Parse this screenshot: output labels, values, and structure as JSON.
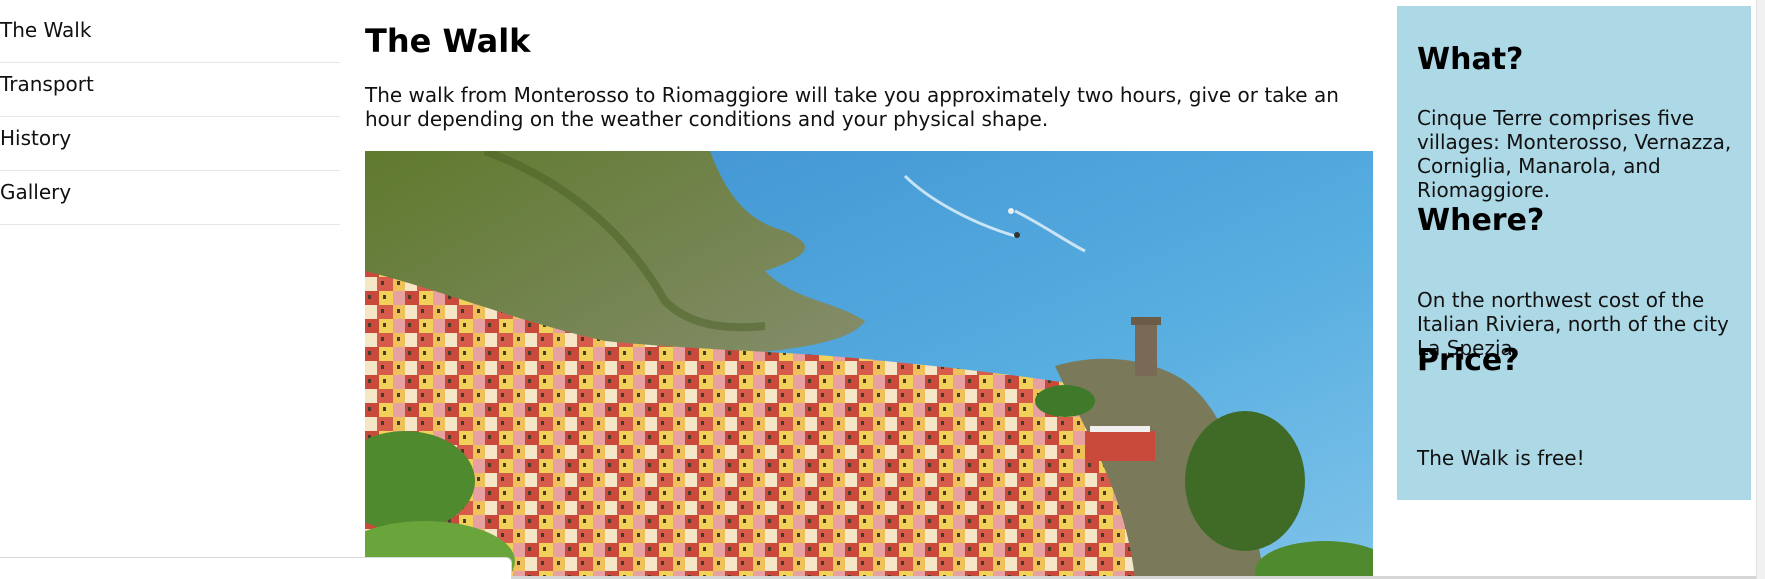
{
  "nav": {
    "items": [
      {
        "label": "The Walk"
      },
      {
        "label": "Transport"
      },
      {
        "label": "History"
      },
      {
        "label": "Gallery"
      }
    ]
  },
  "main": {
    "title": "The Walk",
    "intro": "The walk from Monterosso to Riomaggiore will take you approximately two hours, give or take an hour depending on the weather conditions and your physical shape."
  },
  "aside": {
    "what_heading": "What?",
    "what_text": "Cinque Terre comprises five villages: Monterosso, Vernazza, Corniglia, Manarola, and Riomaggiore.",
    "where_heading": "Where?",
    "where_text": "On the northwest cost of the Italian Riviera, north of the city La Spezia.",
    "price_heading": "Price?",
    "price_text": "The Walk is free!"
  },
  "colors": {
    "aside_background": "#add8e6",
    "sea": "#4aa6d8",
    "cliff": "#6f8a3a"
  },
  "icons": {
    "photo": "coastal-village-photo"
  }
}
